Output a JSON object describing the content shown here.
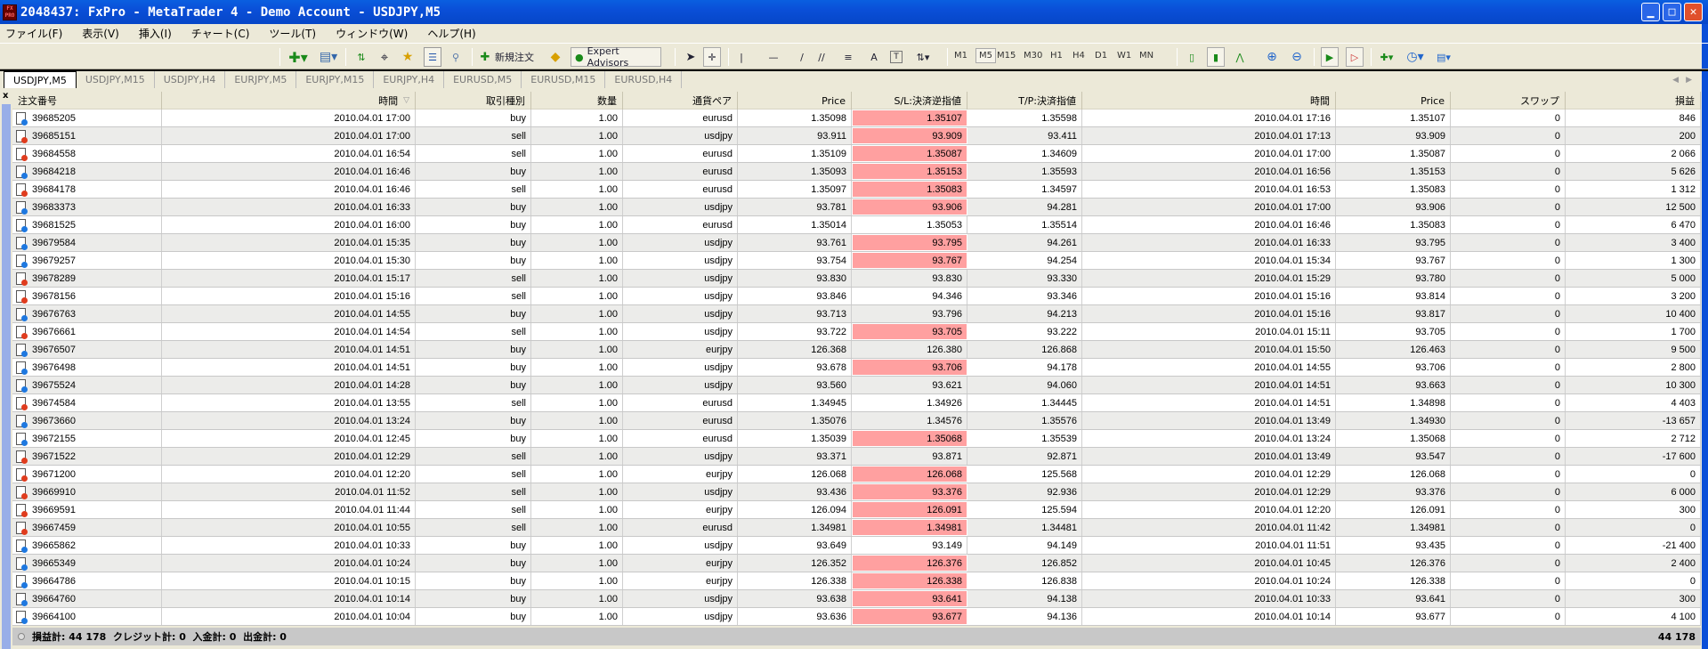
{
  "window": {
    "title": "2048437: FxPro - MetaTrader 4 - Demo Account - USDJPY,M5",
    "logo": "FX PRO"
  },
  "menu": [
    "ファイル(F)",
    "表示(V)",
    "挿入(I)",
    "チャート(C)",
    "ツール(T)",
    "ウィンドウ(W)",
    "ヘルプ(H)"
  ],
  "toolbar": {
    "new_order": "新規注文",
    "expert_advisors": "Expert Advisors",
    "timeframes": [
      "M1",
      "M5",
      "M15",
      "M30",
      "H1",
      "H4",
      "D1",
      "W1",
      "MN"
    ],
    "active_timeframe": "M5"
  },
  "tabs": [
    "USDJPY,M5",
    "USDJPY,M15",
    "USDJPY,H4",
    "EURJPY,M5",
    "EURJPY,M15",
    "EURJPY,H4",
    "EURUSD,M5",
    "EURUSD,M15",
    "EURUSD,H4"
  ],
  "active_tab": "USDJPY,M5",
  "columns": [
    "注文番号",
    "時間",
    "取引種別",
    "数量",
    "通貨ペア",
    "Price",
    "S/L:決済逆指値",
    "T/P:決済指値",
    "時間",
    "Price",
    "スワップ",
    "損益"
  ],
  "colors": {
    "buy": "#1e78e0",
    "sell": "#e03c1e",
    "sl_highlight": "#ffa0a0"
  },
  "rows": [
    [
      "39685205",
      "2010.04.01 17:00",
      "buy",
      "1.00",
      "eurusd",
      "1.35098",
      "1.35107",
      "1.35598",
      "2010.04.01 17:16",
      "1.35107",
      "0",
      "846",
      true
    ],
    [
      "39685151",
      "2010.04.01 17:00",
      "sell",
      "1.00",
      "usdjpy",
      "93.911",
      "93.909",
      "93.411",
      "2010.04.01 17:13",
      "93.909",
      "0",
      "200",
      true
    ],
    [
      "39684558",
      "2010.04.01 16:54",
      "sell",
      "1.00",
      "eurusd",
      "1.35109",
      "1.35087",
      "1.34609",
      "2010.04.01 17:00",
      "1.35087",
      "0",
      "2 066",
      true
    ],
    [
      "39684218",
      "2010.04.01 16:46",
      "buy",
      "1.00",
      "eurusd",
      "1.35093",
      "1.35153",
      "1.35593",
      "2010.04.01 16:56",
      "1.35153",
      "0",
      "5 626",
      true
    ],
    [
      "39684178",
      "2010.04.01 16:46",
      "sell",
      "1.00",
      "eurusd",
      "1.35097",
      "1.35083",
      "1.34597",
      "2010.04.01 16:53",
      "1.35083",
      "0",
      "1 312",
      true
    ],
    [
      "39683373",
      "2010.04.01 16:33",
      "buy",
      "1.00",
      "usdjpy",
      "93.781",
      "93.906",
      "94.281",
      "2010.04.01 17:00",
      "93.906",
      "0",
      "12 500",
      true
    ],
    [
      "39681525",
      "2010.04.01 16:00",
      "buy",
      "1.00",
      "eurusd",
      "1.35014",
      "1.35053",
      "1.35514",
      "2010.04.01 16:46",
      "1.35083",
      "0",
      "6 470",
      false
    ],
    [
      "39679584",
      "2010.04.01 15:35",
      "buy",
      "1.00",
      "usdjpy",
      "93.761",
      "93.795",
      "94.261",
      "2010.04.01 16:33",
      "93.795",
      "0",
      "3 400",
      true
    ],
    [
      "39679257",
      "2010.04.01 15:30",
      "buy",
      "1.00",
      "usdjpy",
      "93.754",
      "93.767",
      "94.254",
      "2010.04.01 15:34",
      "93.767",
      "0",
      "1 300",
      true
    ],
    [
      "39678289",
      "2010.04.01 15:17",
      "sell",
      "1.00",
      "usdjpy",
      "93.830",
      "93.830",
      "93.330",
      "2010.04.01 15:29",
      "93.780",
      "0",
      "5 000",
      false
    ],
    [
      "39678156",
      "2010.04.01 15:16",
      "sell",
      "1.00",
      "usdjpy",
      "93.846",
      "94.346",
      "93.346",
      "2010.04.01 15:16",
      "93.814",
      "0",
      "3 200",
      false
    ],
    [
      "39676763",
      "2010.04.01 14:55",
      "buy",
      "1.00",
      "usdjpy",
      "93.713",
      "93.796",
      "94.213",
      "2010.04.01 15:16",
      "93.817",
      "0",
      "10 400",
      false
    ],
    [
      "39676661",
      "2010.04.01 14:54",
      "sell",
      "1.00",
      "usdjpy",
      "93.722",
      "93.705",
      "93.222",
      "2010.04.01 15:11",
      "93.705",
      "0",
      "1 700",
      true
    ],
    [
      "39676507",
      "2010.04.01 14:51",
      "buy",
      "1.00",
      "eurjpy",
      "126.368",
      "126.380",
      "126.868",
      "2010.04.01 15:50",
      "126.463",
      "0",
      "9 500",
      false
    ],
    [
      "39676498",
      "2010.04.01 14:51",
      "buy",
      "1.00",
      "usdjpy",
      "93.678",
      "93.706",
      "94.178",
      "2010.04.01 14:55",
      "93.706",
      "0",
      "2 800",
      true
    ],
    [
      "39675524",
      "2010.04.01 14:28",
      "buy",
      "1.00",
      "usdjpy",
      "93.560",
      "93.621",
      "94.060",
      "2010.04.01 14:51",
      "93.663",
      "0",
      "10 300",
      false
    ],
    [
      "39674584",
      "2010.04.01 13:55",
      "sell",
      "1.00",
      "eurusd",
      "1.34945",
      "1.34926",
      "1.34445",
      "2010.04.01 14:51",
      "1.34898",
      "0",
      "4 403",
      false
    ],
    [
      "39673660",
      "2010.04.01 13:24",
      "buy",
      "1.00",
      "eurusd",
      "1.35076",
      "1.34576",
      "1.35576",
      "2010.04.01 13:49",
      "1.34930",
      "0",
      "-13 657",
      false
    ],
    [
      "39672155",
      "2010.04.01 12:45",
      "buy",
      "1.00",
      "eurusd",
      "1.35039",
      "1.35068",
      "1.35539",
      "2010.04.01 13:24",
      "1.35068",
      "0",
      "2 712",
      true
    ],
    [
      "39671522",
      "2010.04.01 12:29",
      "sell",
      "1.00",
      "usdjpy",
      "93.371",
      "93.871",
      "92.871",
      "2010.04.01 13:49",
      "93.547",
      "0",
      "-17 600",
      false
    ],
    [
      "39671200",
      "2010.04.01 12:20",
      "sell",
      "1.00",
      "eurjpy",
      "126.068",
      "126.068",
      "125.568",
      "2010.04.01 12:29",
      "126.068",
      "0",
      "0",
      true
    ],
    [
      "39669910",
      "2010.04.01 11:52",
      "sell",
      "1.00",
      "usdjpy",
      "93.436",
      "93.376",
      "92.936",
      "2010.04.01 12:29",
      "93.376",
      "0",
      "6 000",
      true
    ],
    [
      "39669591",
      "2010.04.01 11:44",
      "sell",
      "1.00",
      "eurjpy",
      "126.094",
      "126.091",
      "125.594",
      "2010.04.01 12:20",
      "126.091",
      "0",
      "300",
      true
    ],
    [
      "39667459",
      "2010.04.01 10:55",
      "sell",
      "1.00",
      "eurusd",
      "1.34981",
      "1.34981",
      "1.34481",
      "2010.04.01 11:42",
      "1.34981",
      "0",
      "0",
      true
    ],
    [
      "39665862",
      "2010.04.01 10:33",
      "buy",
      "1.00",
      "usdjpy",
      "93.649",
      "93.149",
      "94.149",
      "2010.04.01 11:51",
      "93.435",
      "0",
      "-21 400",
      false
    ],
    [
      "39665349",
      "2010.04.01 10:24",
      "buy",
      "1.00",
      "eurjpy",
      "126.352",
      "126.376",
      "126.852",
      "2010.04.01 10:45",
      "126.376",
      "0",
      "2 400",
      true
    ],
    [
      "39664786",
      "2010.04.01 10:15",
      "buy",
      "1.00",
      "eurjpy",
      "126.338",
      "126.338",
      "126.838",
      "2010.04.01 10:24",
      "126.338",
      "0",
      "0",
      true
    ],
    [
      "39664760",
      "2010.04.01 10:14",
      "buy",
      "1.00",
      "usdjpy",
      "93.638",
      "93.641",
      "94.138",
      "2010.04.01 10:33",
      "93.641",
      "0",
      "300",
      true
    ],
    [
      "39664100",
      "2010.04.01 10:04",
      "buy",
      "1.00",
      "usdjpy",
      "93.636",
      "93.677",
      "94.136",
      "2010.04.01 10:14",
      "93.677",
      "0",
      "4 100",
      true
    ]
  ],
  "footer": {
    "summary": "損益計: 44 178  クレジット計: 0  入金計: 0  出金計: 0",
    "total": "44 178"
  },
  "terminal_close": "x"
}
